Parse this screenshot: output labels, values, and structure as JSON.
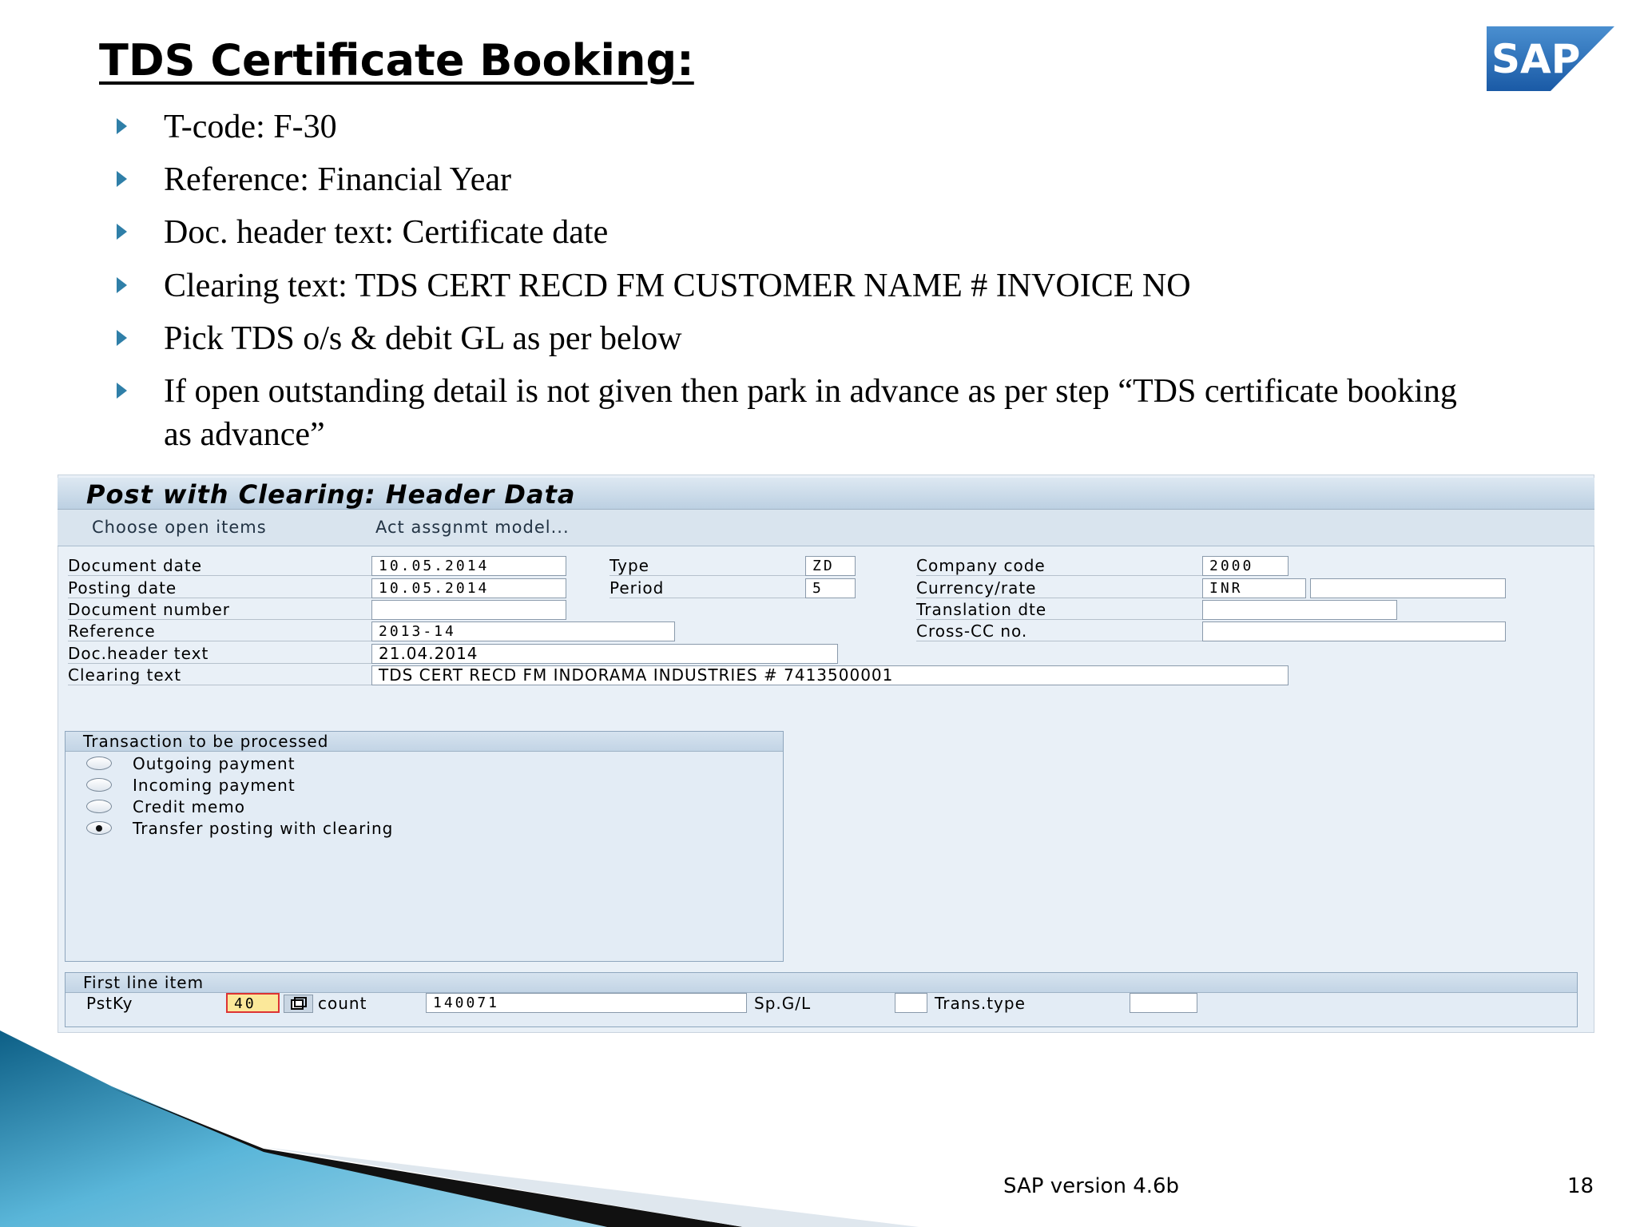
{
  "slide": {
    "title": "TDS Certificate Booking:",
    "logo_text": "SAP",
    "bullets": [
      "T-code: F-30",
      "Reference: Financial Year",
      "Doc. header text: Certificate date",
      "Clearing text: TDS CERT RECD FM CUSTOMER NAME # INVOICE NO",
      "Pick TDS o/s & debit GL as per below",
      "If open outstanding detail is not given then park in advance as per step “TDS certificate booking as advance”"
    ],
    "footer": "SAP version 4.6b",
    "page_number": "18"
  },
  "sap": {
    "title": "Post with Clearing: Header Data",
    "toolbar": {
      "choose_open_items": "Choose open items",
      "act_assgnmt_model": "Act assgnmt model..."
    },
    "fields": {
      "document_date": {
        "label": "Document date",
        "value": "10.05.2014"
      },
      "posting_date": {
        "label": "Posting date",
        "value": "10.05.2014"
      },
      "document_number": {
        "label": "Document number",
        "value": ""
      },
      "reference": {
        "label": "Reference",
        "value": "2013-14"
      },
      "doc_header_text": {
        "label": "Doc.header text",
        "value": "21.04.2014"
      },
      "clearing_text": {
        "label": "Clearing text",
        "value": "TDS CERT RECD FM INDORAMA INDUSTRIES # 7413500001"
      },
      "type": {
        "label": "Type",
        "value": "ZD"
      },
      "period": {
        "label": "Period",
        "value": "5"
      },
      "company_code": {
        "label": "Company code",
        "value": "2000"
      },
      "currency_rate": {
        "label": "Currency/rate",
        "value": "INR",
        "rate": ""
      },
      "translation_dte": {
        "label": "Translation dte",
        "value": ""
      },
      "cross_cc_no": {
        "label": "Cross-CC no.",
        "value": ""
      }
    },
    "transaction": {
      "heading": "Transaction to be processed",
      "options": [
        "Outgoing payment",
        "Incoming payment",
        "Credit memo",
        "Transfer posting with clearing"
      ],
      "selected": "Transfer posting with clearing"
    },
    "first_line_item": {
      "heading": "First line item",
      "pstky_label": "PstKy",
      "pstky_value": "40",
      "account_label": "count",
      "account_value": "140071",
      "spgl_label": "Sp.G/L",
      "spgl_value": "",
      "trans_type_label": "Trans.type",
      "trans_type_value": ""
    }
  }
}
